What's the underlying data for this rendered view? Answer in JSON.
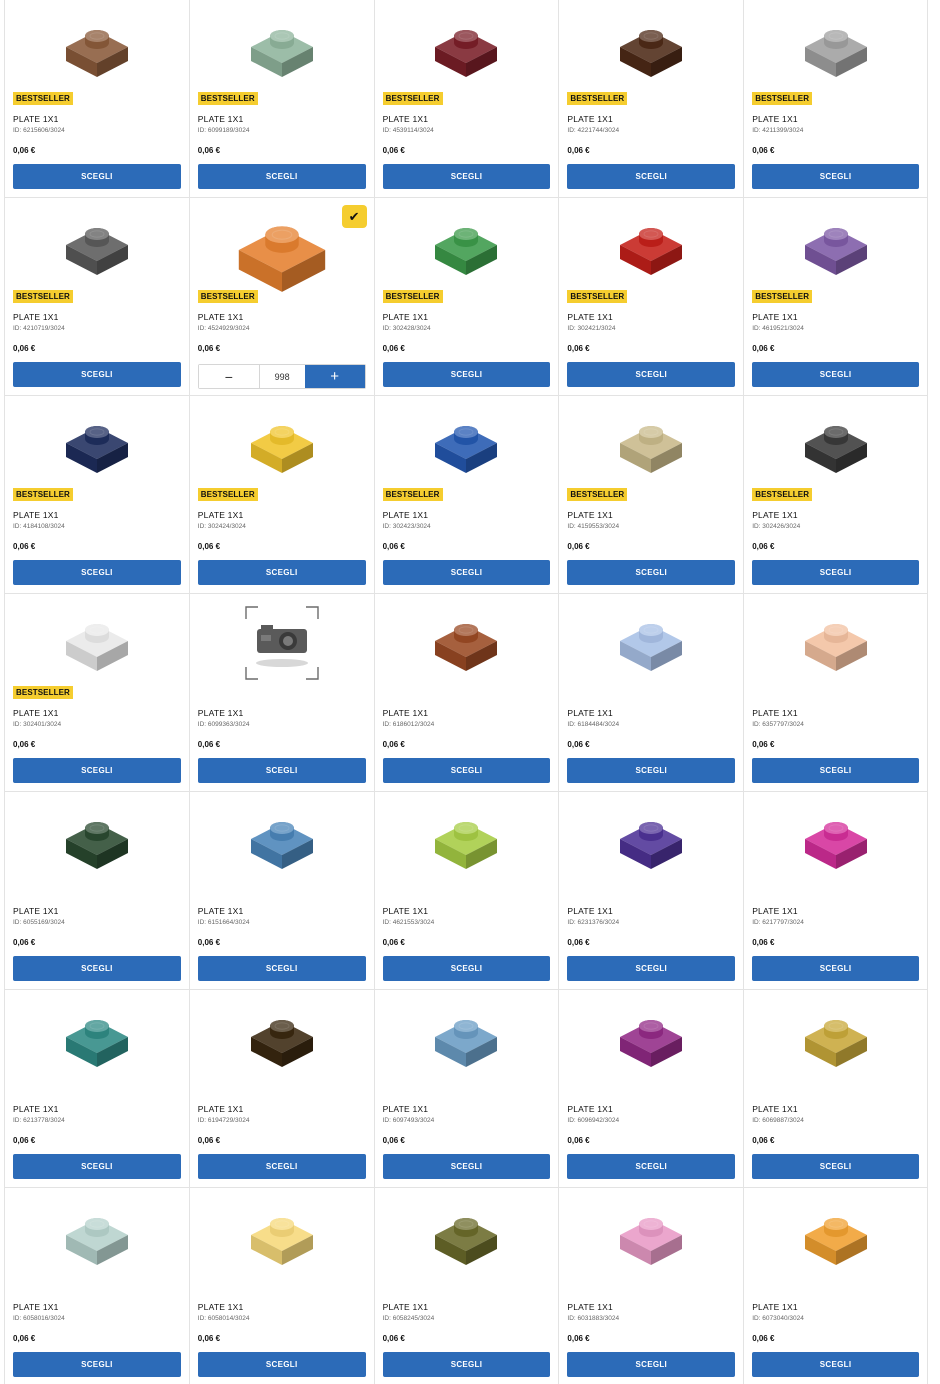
{
  "labels": {
    "badge": "BESTSELLER",
    "choose": "SCEGLI",
    "selected_check": "✔",
    "minus": "−",
    "plus": "+"
  },
  "products": [
    {
      "title": "PLATE 1X1",
      "id": "ID: 6215606/3024",
      "price": "0,06 €",
      "color": "#8a5a3a",
      "bestseller": true
    },
    {
      "title": "PLATE 1X1",
      "id": "ID: 6099189/3024",
      "price": "0,06 €",
      "color": "#8fb49c",
      "bestseller": true
    },
    {
      "title": "PLATE 1X1",
      "id": "ID: 4539114/3024",
      "price": "0,06 €",
      "color": "#7a1f28",
      "bestseller": true
    },
    {
      "title": "PLATE 1X1",
      "id": "ID: 4221744/3024",
      "price": "0,06 €",
      "color": "#4e2a17",
      "bestseller": true
    },
    {
      "title": "PLATE 1X1",
      "id": "ID: 4211399/3024",
      "price": "0,06 €",
      "color": "#a0a0a0",
      "bestseller": true
    },
    {
      "title": "PLATE 1X1",
      "id": "ID: 4210719/3024",
      "price": "0,06 €",
      "color": "#5a5a5a",
      "bestseller": true
    },
    {
      "title": "PLATE 1X1",
      "id": "ID: 4524929/3024",
      "price": "0,06 €",
      "color": "#e5802f",
      "bestseller": true,
      "selected": true,
      "quantity": "998"
    },
    {
      "title": "PLATE 1X1",
      "id": "ID: 302428/3024",
      "price": "0,06 €",
      "color": "#3c9a4a",
      "bestseller": true
    },
    {
      "title": "PLATE 1X1",
      "id": "ID: 302421/3024",
      "price": "0,06 €",
      "color": "#c4201a",
      "bestseller": true
    },
    {
      "title": "PLATE 1X1",
      "id": "ID: 4619521/3024",
      "price": "0,06 €",
      "color": "#7e5aa6",
      "bestseller": true
    },
    {
      "title": "PLATE 1X1",
      "id": "ID: 4184108/3024",
      "price": "0,06 €",
      "color": "#1f2e5e",
      "bestseller": true
    },
    {
      "title": "PLATE 1X1",
      "id": "ID: 302424/3024",
      "price": "0,06 €",
      "color": "#f0c42c",
      "bestseller": true
    },
    {
      "title": "PLATE 1X1",
      "id": "ID: 302423/3024",
      "price": "0,06 €",
      "color": "#2458b0",
      "bestseller": true
    },
    {
      "title": "PLATE 1X1",
      "id": "ID: 4159553/3024",
      "price": "0,06 €",
      "color": "#c8b98a",
      "bestseller": true
    },
    {
      "title": "PLATE 1X1",
      "id": "ID: 302426/3024",
      "price": "0,06 €",
      "color": "#3a3a3a",
      "bestseller": true
    },
    {
      "title": "PLATE 1X1",
      "id": "ID: 302401/3024",
      "price": "0,06 €",
      "color": "#e8e8e8",
      "bestseller": true
    },
    {
      "title": "PLATE 1X1",
      "id": "ID: 6099363/3024",
      "price": "0,06 €",
      "color": "",
      "bestseller": false,
      "placeholder": true
    },
    {
      "title": "PLATE 1X1",
      "id": "ID: 6186012/3024",
      "price": "0,06 €",
      "color": "#9a4a24",
      "bestseller": false
    },
    {
      "title": "PLATE 1X1",
      "id": "ID: 6184484/3024",
      "price": "0,06 €",
      "color": "#a8c0e6",
      "bestseller": false
    },
    {
      "title": "PLATE 1X1",
      "id": "ID: 6357797/3024",
      "price": "0,06 €",
      "color": "#f2c0a0",
      "bestseller": false
    },
    {
      "title": "PLATE 1X1",
      "id": "ID: 6055169/3024",
      "price": "0,06 €",
      "color": "#2a4a30",
      "bestseller": false
    },
    {
      "title": "PLATE 1X1",
      "id": "ID: 6151664/3024",
      "price": "0,06 €",
      "color": "#4a84b8",
      "bestseller": false
    },
    {
      "title": "PLATE 1X1",
      "id": "ID: 4621553/3024",
      "price": "0,06 €",
      "color": "#a6cc44",
      "bestseller": false
    },
    {
      "title": "PLATE 1X1",
      "id": "ID: 6231376/3024",
      "price": "0,06 €",
      "color": "#4e3296",
      "bestseller": false
    },
    {
      "title": "PLATE 1X1",
      "id": "ID: 6217797/3024",
      "price": "0,06 €",
      "color": "#d42e9a",
      "bestseller": false
    },
    {
      "title": "PLATE 1X1",
      "id": "ID: 6213778/3024",
      "price": "0,06 €",
      "color": "#2f8a84",
      "bestseller": false
    },
    {
      "title": "PLATE 1X1",
      "id": "ID: 6194729/3024",
      "price": "0,06 €",
      "color": "#3a2810",
      "bestseller": false
    },
    {
      "title": "PLATE 1X1",
      "id": "ID: 6097493/3024",
      "price": "0,06 €",
      "color": "#6a9cc4",
      "bestseller": false
    },
    {
      "title": "PLATE 1X1",
      "id": "ID: 6096942/3024",
      "price": "0,06 €",
      "color": "#922a86",
      "bestseller": false
    },
    {
      "title": "PLATE 1X1",
      "id": "ID: 6069887/3024",
      "price": "0,06 €",
      "color": "#c8a83a",
      "bestseller": false
    },
    {
      "title": "PLATE 1X1",
      "id": "ID: 6058016/3024",
      "price": "0,06 €",
      "color": "#b6d2cc",
      "bestseller": false
    },
    {
      "title": "PLATE 1X1",
      "id": "ID: 6058014/3024",
      "price": "0,06 €",
      "color": "#f6d87a",
      "bestseller": false
    },
    {
      "title": "PLATE 1X1",
      "id": "ID: 6058245/3024",
      "price": "0,06 €",
      "color": "#6a6a2a",
      "bestseller": false
    },
    {
      "title": "PLATE 1X1",
      "id": "ID: 6031883/3024",
      "price": "0,06 €",
      "color": "#e89ac6",
      "bestseller": false
    },
    {
      "title": "PLATE 1X1",
      "id": "ID: 6073040/3024",
      "price": "0,06 €",
      "color": "#f0a030",
      "bestseller": false
    }
  ]
}
